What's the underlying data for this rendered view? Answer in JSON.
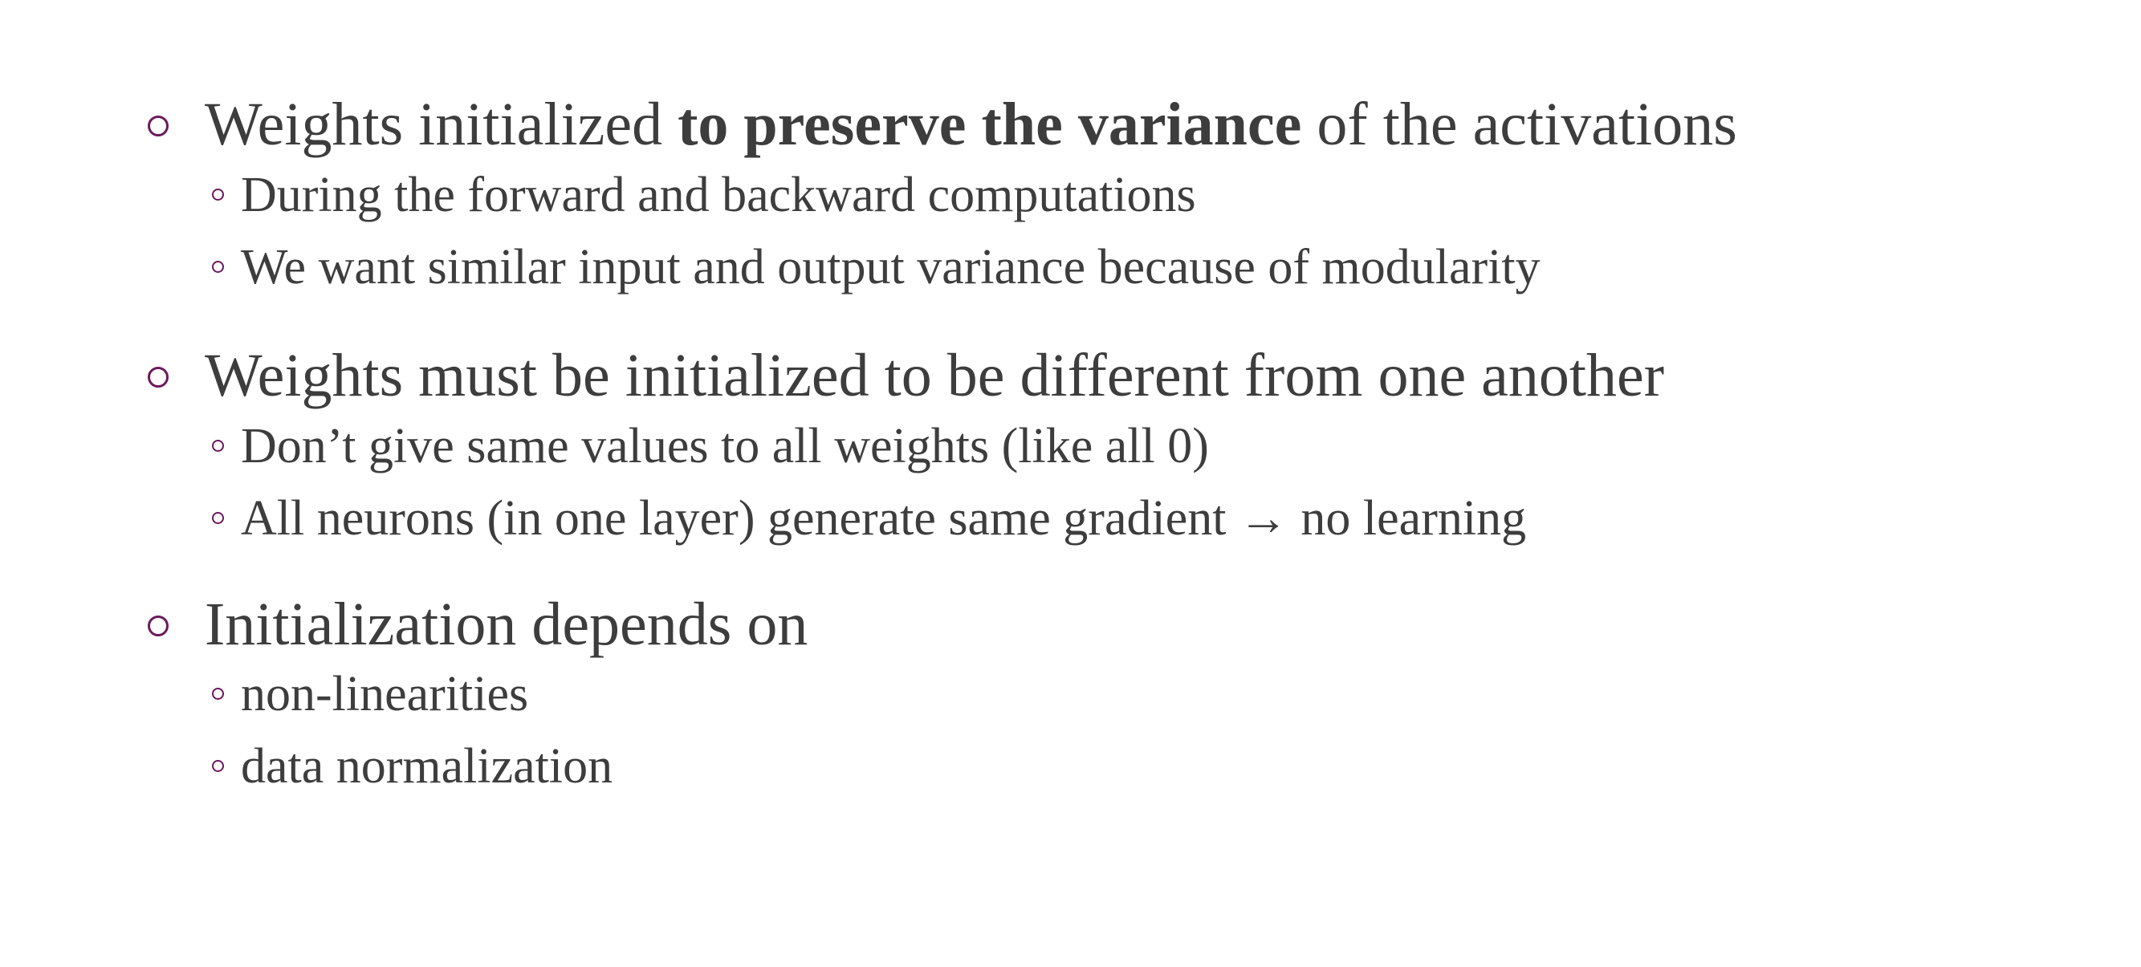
{
  "bullets": [
    {
      "parts": [
        {
          "text": "Weights initialized ",
          "bold": false
        },
        {
          "text": "to preserve the variance",
          "bold": true
        },
        {
          "text": " of the activations",
          "bold": false
        }
      ],
      "subs": [
        "During the forward and backward computations",
        "We want similar input and output variance because of modularity"
      ]
    },
    {
      "parts": [
        {
          "text": "Weights must be initialized to be different from one another",
          "bold": false
        }
      ],
      "subs": [
        "Don’t give same values to all weights (like all 0)",
        "All neurons (in one layer) generate same gradient → no learning"
      ]
    },
    {
      "parts": [
        {
          "text": "Initialization depends on",
          "bold": false
        }
      ],
      "subs": [
        "non-linearities",
        "data normalization"
      ]
    }
  ],
  "colors": {
    "text": "#3d3d3d",
    "bullet_accent": "#6b1a5c",
    "background": "#ffffff"
  },
  "icons": {
    "main_bullet": "hollow-circle-icon",
    "sub_bullet": "small-hollow-circle-icon"
  }
}
